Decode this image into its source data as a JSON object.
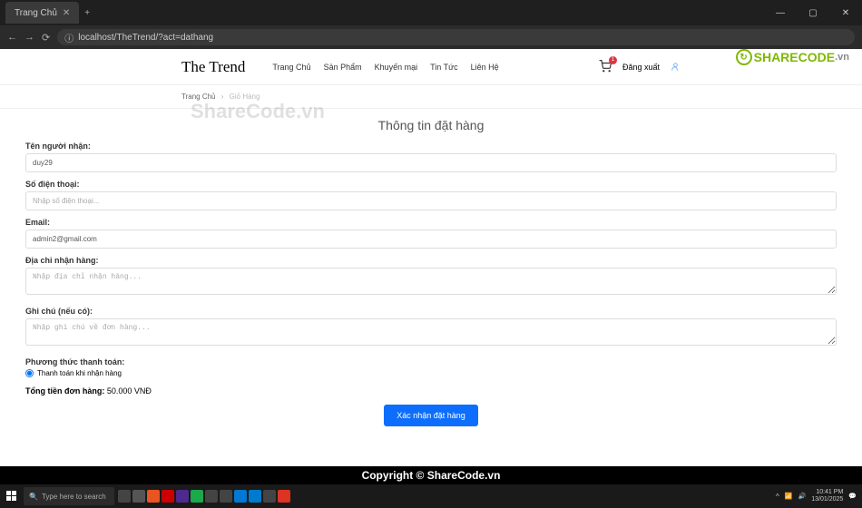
{
  "browser": {
    "tab_title": "Trang Chủ",
    "url": "localhost/TheTrend/?act=dathang"
  },
  "watermarks": {
    "center": "ShareCode.vn",
    "logo_text": "SHARECODE",
    "logo_suffix": ".vn"
  },
  "header": {
    "brand": "The Trend",
    "nav": [
      "Trang Chủ",
      "Sản Phẩm",
      "Khuyến mại",
      "Tin Tức",
      "Liên Hệ"
    ],
    "cart_count": "1",
    "logout": "Đăng xuất"
  },
  "breadcrumb": {
    "home": "Trang Chủ",
    "current": "Giỏ Hàng"
  },
  "form": {
    "title": "Thông tin đặt hàng",
    "recipient_label": "Tên người nhận:",
    "recipient_value": "duy29",
    "phone_label": "Số điện thoại:",
    "phone_placeholder": "Nhập số điện thoại...",
    "email_label": "Email:",
    "email_value": "admin2@gmail.com",
    "address_label": "Địa chỉ nhận hàng:",
    "address_placeholder": "Nhập địa chỉ nhận hàng...",
    "note_label": "Ghi chú (nếu có):",
    "note_placeholder": "Nhập ghi chú về đơn hàng...",
    "pay_method_label": "Phương thức thanh toán:",
    "pay_cod": "Thanh toán khi nhận hàng",
    "total_label": "Tổng tiền đơn hàng:",
    "total_value": "50.000 VNĐ",
    "submit": "Xác nhận đặt hàng"
  },
  "footer": {
    "copy": "Copyright © ShareCode.vn"
  },
  "taskbar": {
    "search_placeholder": "Type here to search",
    "time": "10:41 PM",
    "date": "13/01/2025"
  }
}
